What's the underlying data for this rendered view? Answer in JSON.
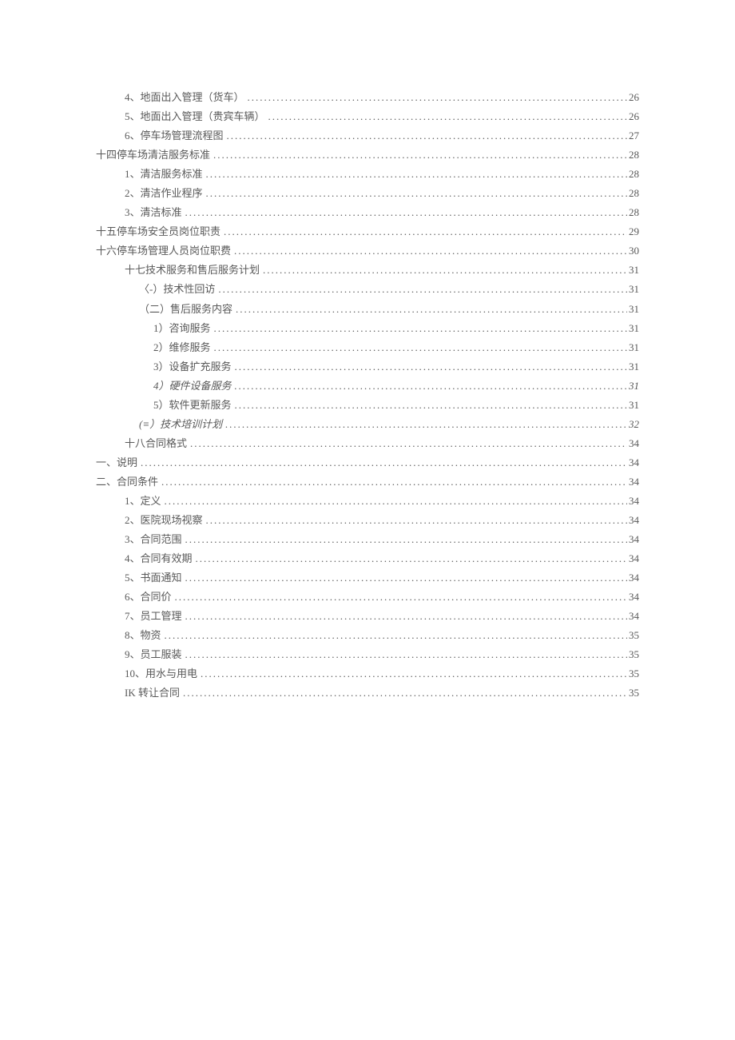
{
  "entries": [
    {
      "title": "4、地面出入管理（货车）",
      "page": "26",
      "indent": 1
    },
    {
      "title": "5、地面出入管理（贵宾车辆）",
      "page": "26",
      "indent": 1
    },
    {
      "title": "6、停车场管理流程图",
      "page": "27",
      "indent": 1
    },
    {
      "title": "十四停车场清洁服务标准",
      "page": "28",
      "indent": 0
    },
    {
      "title": "1、清洁服务标准",
      "page": "28",
      "indent": 1
    },
    {
      "title": "2、清洁作业程序",
      "page": "28",
      "indent": 1
    },
    {
      "title": "3、清洁标准",
      "page": "28",
      "indent": 1
    },
    {
      "title": "十五停车场安全员岗位职责",
      "page": "29",
      "indent": 0
    },
    {
      "title": "十六停车场管理人员岗位职费",
      "page": "30",
      "indent": 0
    },
    {
      "title": "十七技术服务和售后服务计划",
      "page": "31",
      "indent": 1
    },
    {
      "title": "〈-）技术性回访",
      "page": "31",
      "indent": 2
    },
    {
      "title": "（二）售后服务内容",
      "page": "31",
      "indent": 2
    },
    {
      "title": "1）咨询服务",
      "page": "31",
      "indent": 3
    },
    {
      "title": "2）维修服务",
      "page": "31",
      "indent": 3
    },
    {
      "title": "3）设备扩充服务",
      "page": "31",
      "indent": 3
    },
    {
      "title": "4）硬件设备服务",
      "page": "31",
      "indent": 3,
      "italic": true
    },
    {
      "title": "5）软件更新服务",
      "page": "31",
      "indent": 3
    },
    {
      "title": "(≡）技术培训计划",
      "page": "32",
      "indent": 2,
      "italic": true
    },
    {
      "title": "十八合同格式",
      "page": "34",
      "indent": 1
    },
    {
      "title": "一、说明",
      "page": "34",
      "indent": 0
    },
    {
      "title": "二、合同条件",
      "page": "34",
      "indent": 0
    },
    {
      "title": "1、定义",
      "page": "34",
      "indent": 1
    },
    {
      "title": "2、医院现场视察",
      "page": "34",
      "indent": 1
    },
    {
      "title": "3、合同范围",
      "page": "34",
      "indent": 1
    },
    {
      "title": "4、合同有效期",
      "page": "34",
      "indent": 1
    },
    {
      "title": "5、书面通知",
      "page": "34",
      "indent": 1
    },
    {
      "title": "6、合同价",
      "page": "34",
      "indent": 1
    },
    {
      "title": "7、员工管理",
      "page": "34",
      "indent": 1
    },
    {
      "title": "8、物资",
      "page": "35",
      "indent": 1
    },
    {
      "title": "9、员工服装",
      "page": "35",
      "indent": 1
    },
    {
      "title": "10、用水与用电",
      "page": "35",
      "indent": 1
    },
    {
      "title": "IK 转让合同",
      "page": "35",
      "indent": 1
    }
  ]
}
